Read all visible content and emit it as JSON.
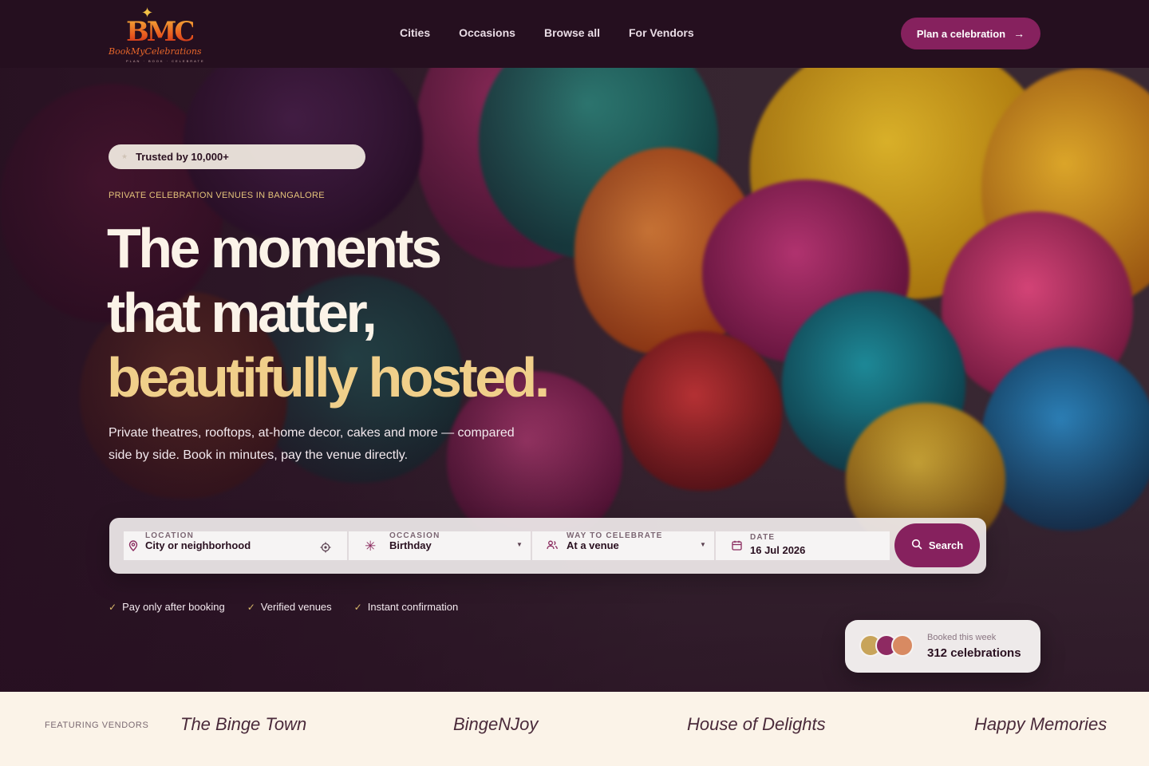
{
  "header": {
    "logo": {
      "mark": "BMC",
      "wordmark": "BookMyCelebrations",
      "tagline": "PLAN · BOOK · CELEBRATE"
    },
    "nav": [
      "Cities",
      "Occasions",
      "Browse all",
      "For Vendors"
    ],
    "cta_label": "Plan a celebration",
    "cta_icon": "arrow-right-icon"
  },
  "hero": {
    "trust_pill": "Trusted by 10,000+",
    "eyebrow": "PRIVATE CELEBRATION VENUES IN BANGALORE",
    "headline_line1": "The moments",
    "headline_line2": "that matter,",
    "headline_line3": "beautifully hosted.",
    "subtext": "Private theatres, rooftops, at-home decor, cakes and more — compared side by side. Book in minutes, pay the venue directly."
  },
  "search": {
    "location": {
      "label": "LOCATION",
      "placeholder": "City or neighborhood",
      "icon": "map-pin-icon",
      "action_icon": "locate-icon"
    },
    "occasion": {
      "label": "OCCASION",
      "value": "Birthday",
      "icon": "sparkle-icon"
    },
    "way": {
      "label": "WAY TO CELEBRATE",
      "value": "At a venue",
      "icon": "users-icon"
    },
    "date": {
      "label": "DATE",
      "value": "16 Jul 2026",
      "icon": "calendar-icon"
    },
    "button_label": "Search",
    "button_icon": "search-icon"
  },
  "perks": [
    "Pay only after booking",
    "Verified venues",
    "Instant confirmation"
  ],
  "booked": {
    "label": "Booked this week",
    "value": "312 celebrations"
  },
  "vendors": {
    "label": "FEATURING VENDORS",
    "names": [
      "The Binge Town",
      "BingeNJoy",
      "House of Delights",
      "Happy Memories"
    ]
  },
  "colors": {
    "header_bg": "#250f1f",
    "accent": "#86215e",
    "gold": "#f0cf8a",
    "cream": "#fbf3e8"
  }
}
